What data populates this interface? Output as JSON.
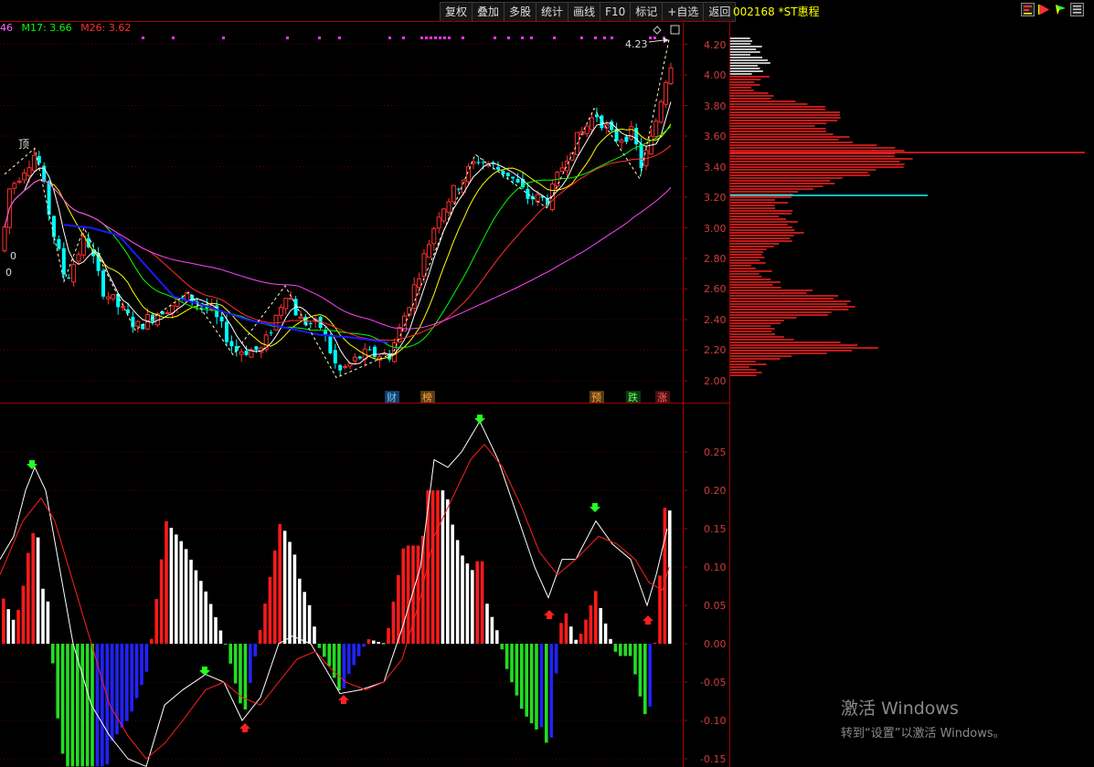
{
  "toolbar": {
    "items": [
      "复权",
      "叠加",
      "多股",
      "统计",
      "画线",
      "F10",
      "标记",
      "+自选",
      "返回"
    ]
  },
  "stock": {
    "code": "002168",
    "name": "*ST惠程"
  },
  "ma_legend": {
    "m1": "46",
    "m17": "M17: 3.66",
    "m26": "M26: 3.62"
  },
  "main_chart": {
    "price_labels": [
      "4.20",
      "4.00",
      "3.80",
      "3.60",
      "3.40",
      "3.20",
      "3.00",
      "2.80",
      "2.60",
      "2.40",
      "2.20",
      "2.00"
    ],
    "price_values": [
      4.2,
      4.0,
      3.8,
      3.6,
      3.4,
      3.2,
      3.0,
      2.8,
      2.6,
      2.4,
      2.2,
      2.0
    ],
    "peak_label": "4.23",
    "top_label": "顶",
    "left_label_1": "0",
    "left_label_2": "0",
    "event_tags": [
      "财",
      "榜",
      "预",
      "跌",
      "涨"
    ]
  },
  "macd_chart": {
    "axis_labels": [
      "0.25",
      "0.20",
      "0.15",
      "0.10",
      "0.05",
      "0.00",
      "-0.05",
      "-0.10",
      "-0.15"
    ],
    "axis_values": [
      0.25,
      0.2,
      0.15,
      0.1,
      0.05,
      0,
      -0.05,
      -0.1,
      -0.15
    ]
  },
  "watermark": {
    "line1": "激活 Windows",
    "line2": "转到“设置”以激活 Windows。"
  },
  "colors": {
    "up": "#ff3030",
    "down": "#00ffff",
    "macd_pos": "#ff0000",
    "macd_neg": "#00d800",
    "blue": "#1a1aff",
    "axis": "#a00000",
    "accent": "#ffff00"
  }
}
